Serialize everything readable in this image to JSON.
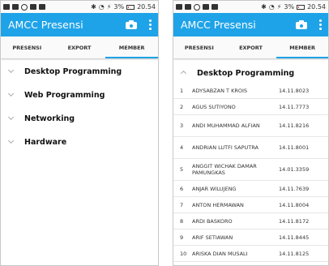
{
  "status": {
    "battery_text": "3%",
    "time": "20.54"
  },
  "app": {
    "title": "AMCC Presensi"
  },
  "tabs": [
    {
      "label": "PRESENSI"
    },
    {
      "label": "EXPORT"
    },
    {
      "label": "MEMBER"
    }
  ],
  "groups": [
    {
      "label": "Desktop Programming"
    },
    {
      "label": "Web Programming"
    },
    {
      "label": "Networking"
    },
    {
      "label": "Hardware"
    }
  ],
  "members": [
    {
      "no": "1",
      "name": "ADYSABZAN T KROIS",
      "nim": "14.11.8023"
    },
    {
      "no": "2",
      "name": "AGUS SUTIYONO",
      "nim": "14.11.7773"
    },
    {
      "no": "3",
      "name": "ANDI MUHAMMAD ALFIAN",
      "nim": "14.11.8216"
    },
    {
      "no": "4",
      "name": "ANDRIAN LUTFI SAPUTRA",
      "nim": "14.11.8001"
    },
    {
      "no": "5",
      "name": "ANGGIT WICHAK DAMAR PAMUNGKAS",
      "nim": "14.01.3359"
    },
    {
      "no": "6",
      "name": "ANJAR WILUJENG",
      "nim": "14.11.7639"
    },
    {
      "no": "7",
      "name": "ANTON HERMAWAN",
      "nim": "14.11.8004"
    },
    {
      "no": "8",
      "name": "ARDI BASKORO",
      "nim": "14.11.8172"
    },
    {
      "no": "9",
      "name": "ARIF SETIAWAN",
      "nim": "14.11.8445"
    },
    {
      "no": "10",
      "name": "ARISKA DIAN MUSALI",
      "nim": "14.11.8125"
    }
  ],
  "colors": {
    "primary": "#1fa3e8",
    "tab_bg": "#fafafa"
  }
}
